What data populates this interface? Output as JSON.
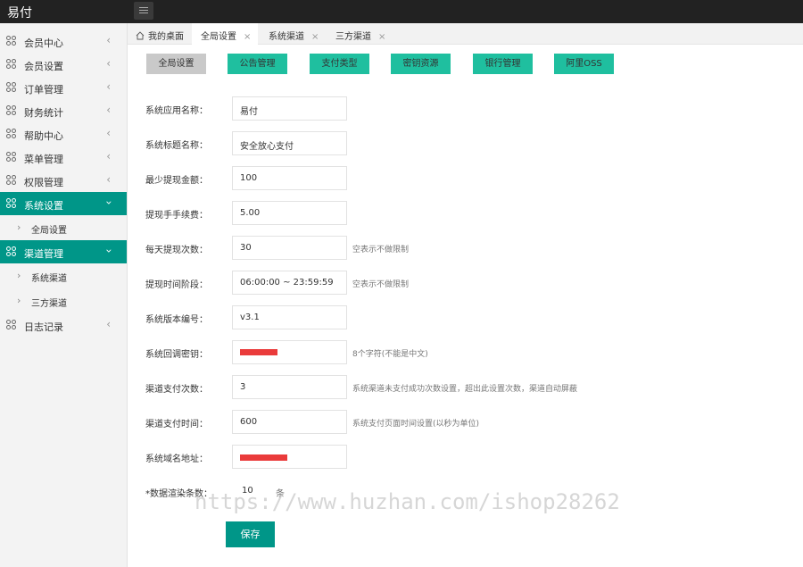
{
  "app": {
    "title": "易付"
  },
  "sidebar": {
    "items": [
      {
        "label": "会员中心",
        "arrow": "‹"
      },
      {
        "label": "会员设置",
        "arrow": "‹"
      },
      {
        "label": "订单管理",
        "arrow": "‹"
      },
      {
        "label": "财务统计",
        "arrow": "‹"
      },
      {
        "label": "帮助中心",
        "arrow": "‹"
      },
      {
        "label": "菜单管理",
        "arrow": "‹"
      },
      {
        "label": "权限管理",
        "arrow": "‹"
      },
      {
        "label": "系统设置",
        "arrow": "‹"
      },
      {
        "label": "渠道管理",
        "arrow": "‹"
      },
      {
        "label": "日志记录",
        "arrow": "‹"
      }
    ],
    "sub_system": [
      {
        "label": "全局设置",
        "chev": "›"
      }
    ],
    "sub_channel": [
      {
        "label": "系统渠道",
        "chev": "›"
      },
      {
        "label": "三方渠道",
        "chev": "›"
      }
    ]
  },
  "tabs": [
    {
      "label": "我的桌面"
    },
    {
      "label": "全局设置",
      "close": "×"
    },
    {
      "label": "系统渠道",
      "close": "×"
    },
    {
      "label": "三方渠道",
      "close": "×"
    }
  ],
  "buttons": [
    "全局设置",
    "公告管理",
    "支付类型",
    "密钥资源",
    "银行管理",
    "阿里OSS"
  ],
  "form": [
    {
      "label": "系统应用名称：",
      "value": "易付",
      "hint": ""
    },
    {
      "label": "系统标题名称：",
      "value": "安全放心支付",
      "hint": ""
    },
    {
      "label": "最少提现金额：",
      "value": "100",
      "hint": ""
    },
    {
      "label": "提现手手续费：",
      "value": "5.00",
      "hint": ""
    },
    {
      "label": "每天提现次数：",
      "value": "30",
      "hint": "空表示不做限制"
    },
    {
      "label": "提现时间阶段：",
      "value": "06:00:00 ~ 23:59:59",
      "hint": "空表示不做限制"
    },
    {
      "label": "系统版本编号：",
      "value": "v3.1",
      "hint": ""
    },
    {
      "label": "系统回调密钥：",
      "value": "",
      "hint": "8个字符(不能是中文)"
    },
    {
      "label": "渠道支付次数：",
      "value": "3",
      "hint": "系统渠道未支付成功次数设置，超出此设置次数，渠道自动屏蔽"
    },
    {
      "label": "渠道支付时间：",
      "value": "600",
      "hint": "系统支付页面时间设置(以秒为单位)"
    },
    {
      "label": "系统域名地址：",
      "value": "",
      "hint": ""
    }
  ],
  "render_count": {
    "label": "*数据渲染条数：",
    "value": "10",
    "unit": "条"
  },
  "save_label": "保存",
  "watermark": "https://www.huzhan.com/ishop28262",
  "colors": {
    "accent": "#009688",
    "button_teal": "#1fbf9f",
    "redaction": "#ea3b3b"
  }
}
